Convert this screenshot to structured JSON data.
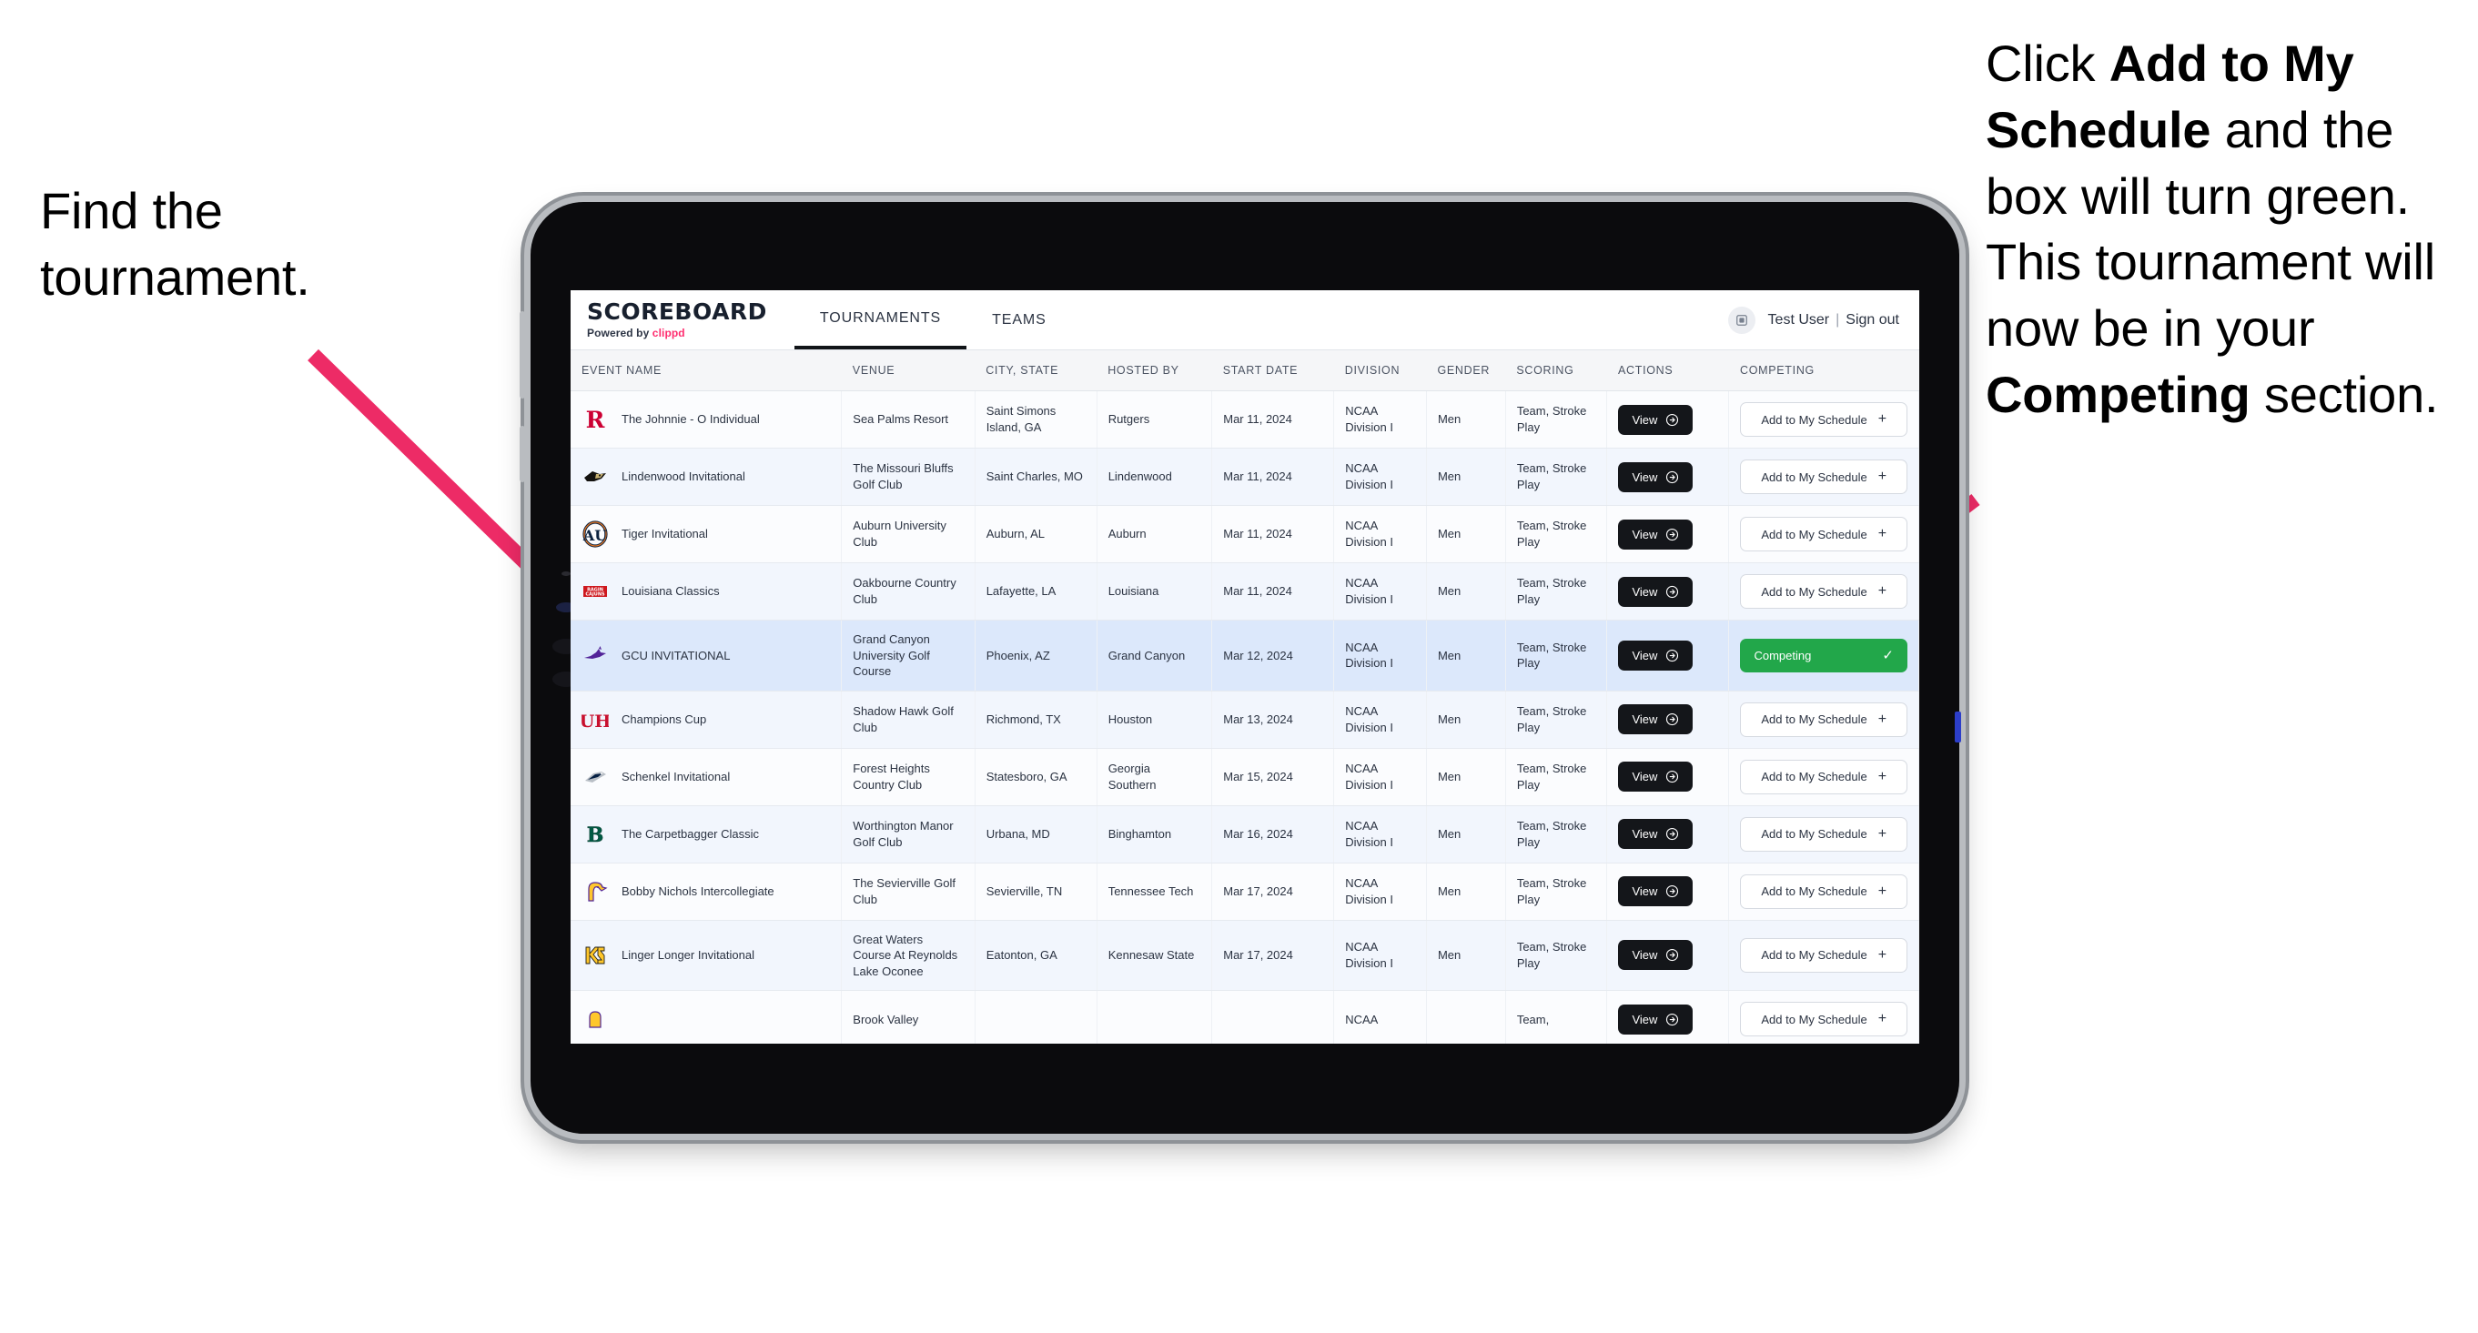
{
  "annotations": {
    "left": {
      "line1": "Find the",
      "line2": "tournament."
    },
    "right": {
      "seg1": "Click ",
      "bold1": "Add to My Schedule",
      "seg2": " and the box will turn green. This tournament will now be in your ",
      "bold2": "Competing",
      "seg3": " section."
    },
    "arrow_color": "#ed2b66"
  },
  "app": {
    "brand": {
      "name": "SCOREBOARD",
      "powered_prefix": "Powered by ",
      "powered_brand": "clippd",
      "brand_accent": "#ff2d6f"
    },
    "tabs": [
      {
        "label": "TOURNAMENTS",
        "active": true
      },
      {
        "label": "TEAMS",
        "active": false
      }
    ],
    "user": {
      "avatar_icon": "user-avatar-icon",
      "name": "Test User",
      "separator": "|",
      "signout": "Sign out"
    }
  },
  "table": {
    "columns": [
      "EVENT NAME",
      "VENUE",
      "CITY, STATE",
      "HOSTED BY",
      "START DATE",
      "DIVISION",
      "GENDER",
      "SCORING",
      "ACTIONS",
      "COMPETING"
    ],
    "action_label": "View",
    "add_label": "Add to My Schedule",
    "add_plus": "+",
    "competing_label": "Competing",
    "competing_check": "✓",
    "competing_color": "#22a74a",
    "rows": [
      {
        "logo": "rutgers-logo",
        "event": "The Johnnie - O Individual",
        "venue": "Sea Palms Resort",
        "city": "Saint Simons Island, GA",
        "host": "Rutgers",
        "date": "Mar 11, 2024",
        "division": "NCAA Division I",
        "gender": "Men",
        "scoring": "Team, Stroke Play",
        "competing": false,
        "highlight": false
      },
      {
        "logo": "lindenwood-logo",
        "event": "Lindenwood Invitational",
        "venue": "The Missouri Bluffs Golf Club",
        "city": "Saint Charles, MO",
        "host": "Lindenwood",
        "date": "Mar 11, 2024",
        "division": "NCAA Division I",
        "gender": "Men",
        "scoring": "Team, Stroke Play",
        "competing": false,
        "highlight": false
      },
      {
        "logo": "auburn-logo",
        "event": "Tiger Invitational",
        "venue": "Auburn University Club",
        "city": "Auburn, AL",
        "host": "Auburn",
        "date": "Mar 11, 2024",
        "division": "NCAA Division I",
        "gender": "Men",
        "scoring": "Team, Stroke Play",
        "competing": false,
        "highlight": false
      },
      {
        "logo": "louisiana-logo",
        "event": "Louisiana Classics",
        "venue": "Oakbourne Country Club",
        "city": "Lafayette, LA",
        "host": "Louisiana",
        "date": "Mar 11, 2024",
        "division": "NCAA Division I",
        "gender": "Men",
        "scoring": "Team, Stroke Play",
        "competing": false,
        "highlight": false
      },
      {
        "logo": "gcu-logo",
        "event": "GCU INVITATIONAL",
        "venue": "Grand Canyon University Golf Course",
        "city": "Phoenix, AZ",
        "host": "Grand Canyon",
        "date": "Mar 12, 2024",
        "division": "NCAA Division I",
        "gender": "Men",
        "scoring": "Team, Stroke Play",
        "competing": true,
        "highlight": true
      },
      {
        "logo": "houston-logo",
        "event": "Champions Cup",
        "venue": "Shadow Hawk Golf Club",
        "city": "Richmond, TX",
        "host": "Houston",
        "date": "Mar 13, 2024",
        "division": "NCAA Division I",
        "gender": "Men",
        "scoring": "Team, Stroke Play",
        "competing": false,
        "highlight": false
      },
      {
        "logo": "georgia-southern-logo",
        "event": "Schenkel Invitational",
        "venue": "Forest Heights Country Club",
        "city": "Statesboro, GA",
        "host": "Georgia Southern",
        "date": "Mar 15, 2024",
        "division": "NCAA Division I",
        "gender": "Men",
        "scoring": "Team, Stroke Play",
        "competing": false,
        "highlight": false
      },
      {
        "logo": "binghamton-logo",
        "event": "The Carpetbagger Classic",
        "venue": "Worthington Manor Golf Club",
        "city": "Urbana, MD",
        "host": "Binghamton",
        "date": "Mar 16, 2024",
        "division": "NCAA Division I",
        "gender": "Men",
        "scoring": "Team, Stroke Play",
        "competing": false,
        "highlight": false
      },
      {
        "logo": "tennessee-tech-logo",
        "event": "Bobby Nichols Intercollegiate",
        "venue": "The Sevierville Golf Club",
        "city": "Sevierville, TN",
        "host": "Tennessee Tech",
        "date": "Mar 17, 2024",
        "division": "NCAA Division I",
        "gender": "Men",
        "scoring": "Team, Stroke Play",
        "competing": false,
        "highlight": false
      },
      {
        "logo": "kennesaw-state-logo",
        "event": "Linger Longer Invitational",
        "venue": "Great Waters Course At Reynolds Lake Oconee",
        "city": "Eatonton, GA",
        "host": "Kennesaw State",
        "date": "Mar 17, 2024",
        "division": "NCAA Division I",
        "gender": "Men",
        "scoring": "Team, Stroke Play",
        "competing": false,
        "highlight": false
      },
      {
        "logo": "partial-logo",
        "event": "",
        "venue": "Brook Valley",
        "city": "",
        "host": "",
        "date": "",
        "division": "NCAA",
        "gender": "",
        "scoring": "Team,",
        "competing": false,
        "highlight": false,
        "partial": true
      }
    ]
  }
}
